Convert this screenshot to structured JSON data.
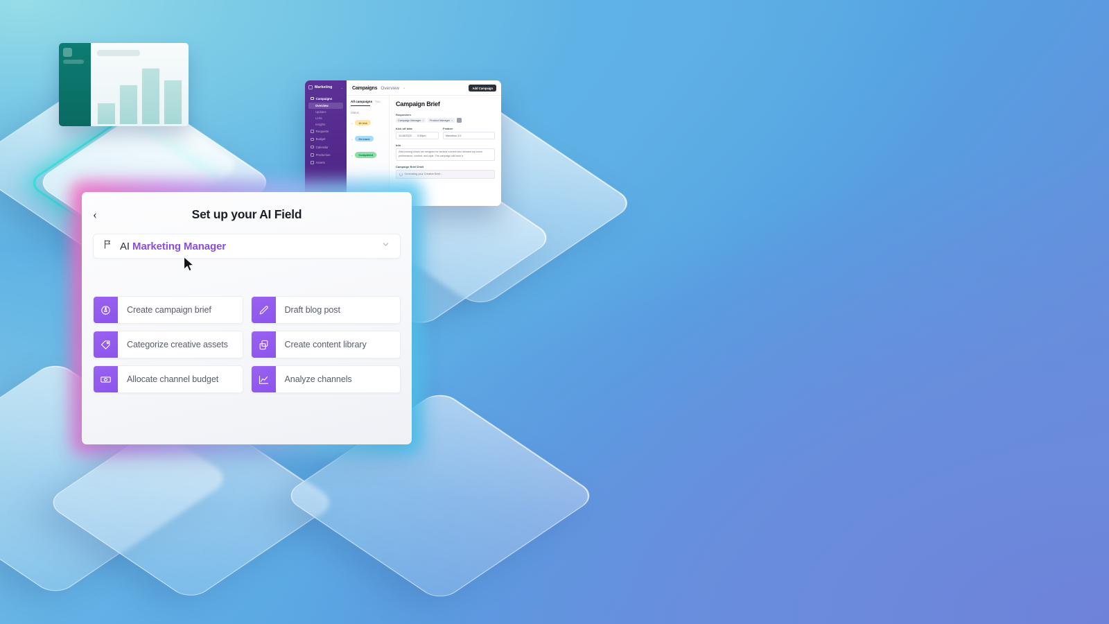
{
  "background": {
    "gradient_from": "#8ED3E4",
    "gradient_mid": "#5AACE4",
    "gradient_to": "#6E84D8",
    "glow_ring_color": "#2DEBDE"
  },
  "chart_card": {
    "sidebar_color": "#0D7C72",
    "bar_color": "#A7D8D6",
    "bars": [
      34,
      62,
      88,
      70
    ]
  },
  "app_window": {
    "sidebar": {
      "brand": "Marketing",
      "brand_caret": "⌄",
      "items": [
        {
          "label": "Campaigns",
          "bold": true
        },
        {
          "label": "Requests",
          "bold": false
        },
        {
          "label": "Budget",
          "bold": false
        },
        {
          "label": "Calendar",
          "bold": false
        },
        {
          "label": "Production",
          "bold": false
        },
        {
          "label": "Assets",
          "bold": false
        }
      ],
      "sub_items": [
        {
          "label": "Overview",
          "active": true
        },
        {
          "label": "Updates",
          "active": false
        },
        {
          "label": "Links",
          "active": false
        },
        {
          "label": "Insights",
          "active": false
        }
      ]
    },
    "topbar": {
      "crumb_primary": "Campaigns",
      "crumb_secondary": "Overview",
      "crumb_caret": "⌄",
      "add_button": "Add Campaign"
    },
    "list_panel": {
      "tab_active": "All campaigns",
      "tab_inactive": "You",
      "group_label": "Status",
      "statuses": [
        {
          "label": "At risk",
          "bg": "#FBE6A8",
          "fg": "#8A6A12"
        },
        {
          "label": "On track",
          "bg": "#A8DCF6",
          "fg": "#145E86"
        },
        {
          "label": "Completed",
          "bg": "#86E0A8",
          "fg": "#14653A"
        }
      ]
    },
    "detail": {
      "title": "Campaign Brief",
      "requesters_label": "Requesters",
      "requester_chips": [
        "Campaign Manager",
        "Product Manager"
      ],
      "chip_remove": "×",
      "kickoff_label": "Kick off date",
      "kickoff_date": "11/18/2023",
      "kickoff_sep": "–",
      "kickoff_time": "3:30pm",
      "feature_label": "Feature",
      "feature_value": "Marathon 3.0",
      "info_label": "Info",
      "info_text": "Zeta running shoes are designed for serious runners who demand top-notch performance, comfort, and style. The campaign will have a",
      "draft_label": "Campaign Brief Draft",
      "draft_status": "Generating your Creative Brief..."
    }
  },
  "modal": {
    "back_icon": "‹",
    "title": "Set up your AI Field",
    "role_select": {
      "icon": "megaphone-icon",
      "prefix": "AI ",
      "accent_text": "Marketing Manager",
      "accent_color": "#8B4DE0",
      "caret_icon": "chevron-down-icon"
    },
    "actions": [
      {
        "label": "Create campaign brief",
        "icon": "target-badge-icon"
      },
      {
        "label": "Draft blog post",
        "icon": "pencil-icon"
      },
      {
        "label": "Categorize creative assets",
        "icon": "tag-icon"
      },
      {
        "label": "Create content library",
        "icon": "copy-stack-icon"
      },
      {
        "label": "Allocate channel budget",
        "icon": "banknote-icon"
      },
      {
        "label": "Analyze channels",
        "icon": "line-chart-icon"
      }
    ],
    "icon_bg": "#8C54EC",
    "glow_from": "#F86FC0",
    "glow_to": "#49C6F0"
  }
}
